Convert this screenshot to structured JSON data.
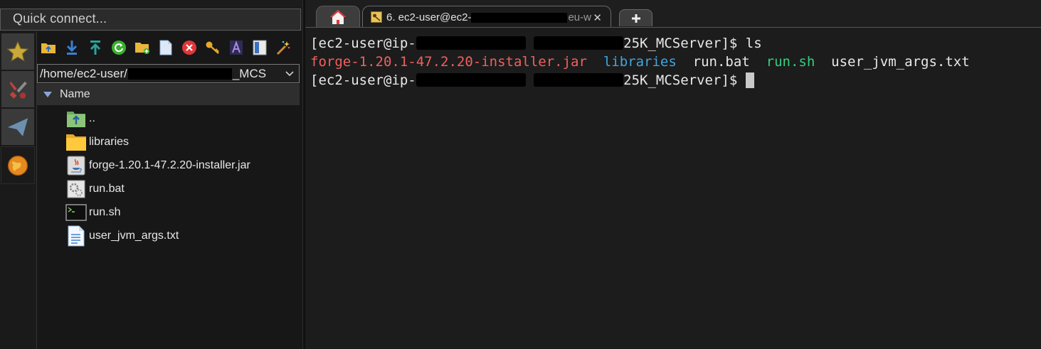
{
  "quick_connect": {
    "placeholder": "Quick connect..."
  },
  "side_tabs": [
    {
      "icon": "star-icon"
    },
    {
      "icon": "tools-icon"
    },
    {
      "icon": "paper-plane-icon"
    },
    {
      "icon": "globe-icon"
    }
  ],
  "toolbar": {
    "buttons": [
      "folder-up-icon",
      "download-icon",
      "upload-icon",
      "refresh-icon",
      "new-folder-icon",
      "new-file-icon",
      "delete-icon",
      "key-icon",
      "rename-icon",
      "properties-icon",
      "magic-wand-icon"
    ]
  },
  "path": {
    "prefix": "/home/ec2-user/",
    "suffix": "_MCS"
  },
  "file_list": {
    "column_name": "Name",
    "items": [
      {
        "name": "..",
        "icon": "parent-folder-icon"
      },
      {
        "name": "libraries",
        "icon": "folder-icon"
      },
      {
        "name": "forge-1.20.1-47.2.20-installer.jar",
        "icon": "java-file-icon"
      },
      {
        "name": "run.bat",
        "icon": "batch-file-icon"
      },
      {
        "name": "run.sh",
        "icon": "shell-script-icon"
      },
      {
        "name": "user_jvm_args.txt",
        "icon": "text-file-icon"
      }
    ]
  },
  "tabs": {
    "home_icon": "home-icon",
    "session": {
      "label_prefix": "6. ec2-user@ec2-",
      "label_suffix": "eu-w",
      "close": "✕"
    },
    "new_tab_icon": "plus-icon"
  },
  "terminal": {
    "prompt_prefix": "[ec2-user@ip-",
    "prompt_suffix": "25K_MCServer]$ ",
    "line1_command": "ls",
    "ls_output": {
      "jar": "forge-1.20.1-47.2.20-installer.jar",
      "dir": "libraries",
      "bat": "run.bat",
      "sh": "run.sh",
      "txt": "user_jvm_args.txt"
    },
    "colors": {
      "jar": "#f1605e",
      "dir": "#3fa7de",
      "sh": "#34d07f"
    }
  }
}
